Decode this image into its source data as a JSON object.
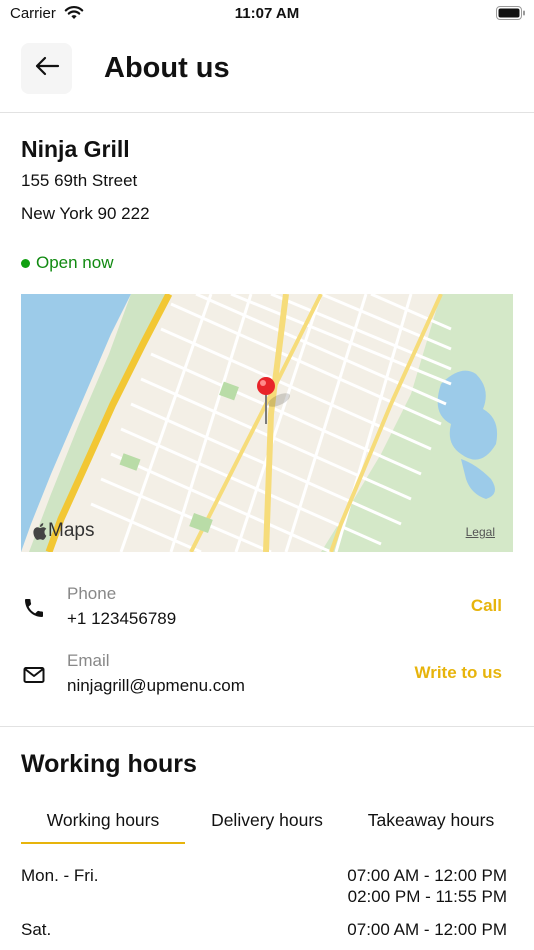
{
  "status_bar": {
    "carrier": "Carrier",
    "time": "11:07 AM"
  },
  "header": {
    "title": "About us",
    "back_icon": "arrow-left-icon"
  },
  "restaurant": {
    "name": "Ninja Grill",
    "address_line1": "155 69th Street",
    "address_line2": "New York 90 222",
    "status": "Open now",
    "status_color": "#118a11"
  },
  "map": {
    "brand": "Maps",
    "legal": "Legal",
    "pin_color": "#e8242a"
  },
  "contacts": [
    {
      "icon": "phone-icon",
      "label": "Phone",
      "value": "+1 123456789",
      "action": "Call"
    },
    {
      "icon": "mail-icon",
      "label": "Email",
      "value": "ninjagrill@upmenu.com",
      "action": "Write to us"
    }
  ],
  "accent_color": "#e7b40c",
  "working_hours": {
    "title": "Working hours",
    "tabs": [
      {
        "label": "Working hours",
        "active": true
      },
      {
        "label": "Delivery hours",
        "active": false
      },
      {
        "label": "Takeaway hours",
        "active": false
      }
    ],
    "rows": [
      {
        "day": "Mon. - Fri.",
        "times": [
          "07:00 AM - 12:00 PM",
          "02:00 PM - 11:55 PM"
        ]
      },
      {
        "day": "Sat.",
        "times": [
          "07:00 AM - 12:00 PM"
        ]
      }
    ]
  }
}
